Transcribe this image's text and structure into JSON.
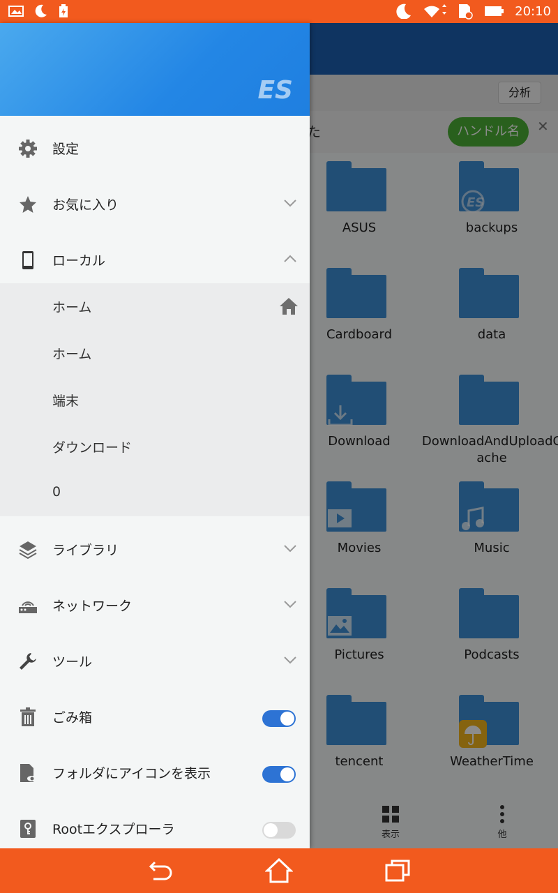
{
  "status_bar": {
    "time": "20:10"
  },
  "background": {
    "crumb": "分析",
    "notice_text": "た",
    "handle_button": "ハンドル名",
    "folders": [
      {
        "label": "ASUS",
        "badge": ""
      },
      {
        "label": "backups",
        "badge": "es"
      },
      {
        "label": "Cardboard",
        "badge": ""
      },
      {
        "label": "data",
        "badge": ""
      },
      {
        "label": "Download",
        "badge": "download"
      },
      {
        "label": "DownloadAndUploadCache",
        "badge": ""
      },
      {
        "label": "Movies",
        "badge": "play"
      },
      {
        "label": "Music",
        "badge": "music"
      },
      {
        "label": "Pictures",
        "badge": "image"
      },
      {
        "label": "Podcasts",
        "badge": ""
      },
      {
        "label": "tencent",
        "badge": ""
      },
      {
        "label": "WeatherTime",
        "badge": "weather"
      }
    ],
    "bottom_actions": [
      {
        "label": "表示",
        "icon": "grid-icon"
      },
      {
        "label": "他",
        "icon": "more-vert-icon"
      }
    ]
  },
  "drawer": {
    "logo": "ES",
    "items": [
      {
        "label": "設定",
        "icon": "gear-icon"
      },
      {
        "label": "お気に入り",
        "icon": "star-icon"
      },
      {
        "label": "ローカル",
        "icon": "phone-icon"
      }
    ],
    "local_sub": [
      "ホーム",
      "ホーム",
      "端末",
      "ダウンロード",
      "0"
    ],
    "items2": [
      {
        "label": "ライブラリ",
        "icon": "layers-icon"
      },
      {
        "label": "ネットワーク",
        "icon": "router-icon"
      },
      {
        "label": "ツール",
        "icon": "wrench-icon"
      }
    ],
    "toggles": [
      {
        "label": "ごみ箱",
        "icon": "trash-icon",
        "on": true
      },
      {
        "label": "フォルダにアイコンを表示",
        "icon": "folder-eye-icon",
        "on": true
      },
      {
        "label": "Rootエクスプローラ",
        "icon": "key-icon",
        "on": false
      }
    ]
  }
}
